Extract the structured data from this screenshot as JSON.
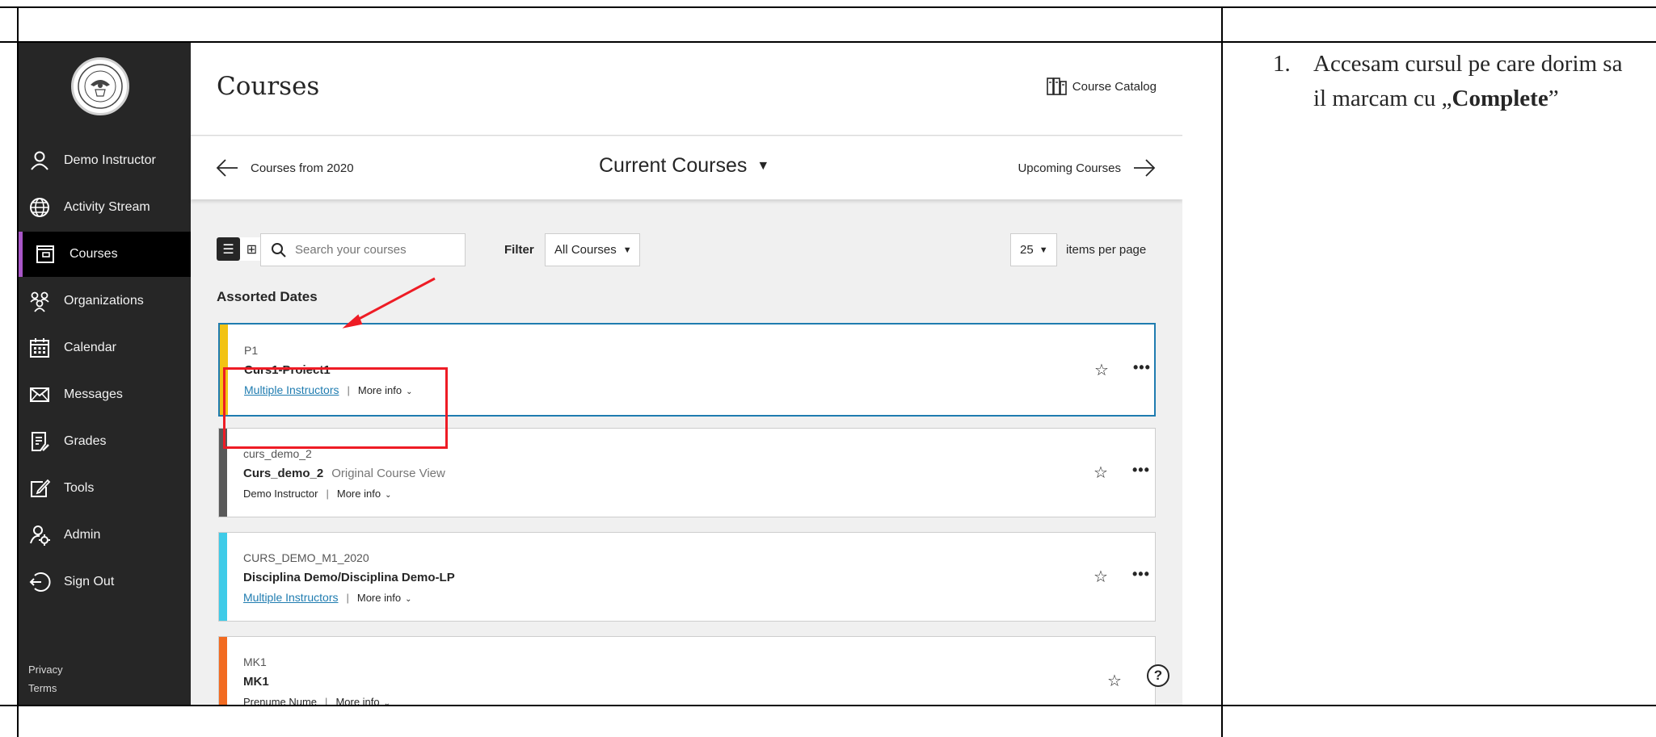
{
  "sidebar": {
    "items": [
      {
        "label": "Demo Instructor",
        "icon": "user-icon"
      },
      {
        "label": "Activity Stream",
        "icon": "globe-icon"
      },
      {
        "label": "Courses",
        "icon": "courses-icon"
      },
      {
        "label": "Organizations",
        "icon": "organizations-icon"
      },
      {
        "label": "Calendar",
        "icon": "calendar-icon"
      },
      {
        "label": "Messages",
        "icon": "envelope-icon"
      },
      {
        "label": "Grades",
        "icon": "grades-icon"
      },
      {
        "label": "Tools",
        "icon": "tools-icon"
      },
      {
        "label": "Admin",
        "icon": "admin-icon"
      },
      {
        "label": "Sign Out",
        "icon": "sign-out-icon"
      }
    ],
    "active_item": "Courses",
    "footer": {
      "privacy": "Privacy",
      "terms": "Terms"
    }
  },
  "header": {
    "title": "Courses",
    "catalog_label": "Course Catalog"
  },
  "term_nav": {
    "previous": "Courses from 2020",
    "current": "Current Courses",
    "next": "Upcoming Courses"
  },
  "toolbar": {
    "search_placeholder": "Search your courses",
    "filter_label": "Filter",
    "filter_value": "All Courses",
    "per_page_value": "25",
    "per_page_label": "items per page"
  },
  "section_title": "Assorted Dates",
  "courses": [
    {
      "code": "P1",
      "name": "Curs1-Proiect1",
      "view_type": "",
      "instructor": "Multiple Instructors",
      "more_info": "More info",
      "stripe_color": "#f2c314"
    },
    {
      "code": "curs_demo_2",
      "name": "Curs_demo_2",
      "view_type": "Original Course View",
      "instructor": "Demo Instructor",
      "more_info": "More info",
      "stripe_color": "#595959"
    },
    {
      "code": "CURS_DEMO_M1_2020",
      "name": "Disciplina Demo/Disciplina Demo-LP",
      "view_type": "",
      "instructor": "Multiple Instructors",
      "more_info": "More info",
      "stripe_color": "#3ecbe8"
    },
    {
      "code": "MK1",
      "name": "MK1",
      "view_type": "",
      "instructor": "Prenume Nume",
      "more_info": "More info",
      "stripe_color": "#f26b21"
    }
  ],
  "help_symbol": "?",
  "note": {
    "number": "1.",
    "text_before": "Accesam cursul pe care dorim sa il marcam cu „",
    "bold": "Complete",
    "text_after": "”"
  },
  "colors": {
    "sidebar_bg": "#262626",
    "active_accent": "#a956c8",
    "link": "#1f7cb0",
    "highlight": "#ee1c25"
  }
}
